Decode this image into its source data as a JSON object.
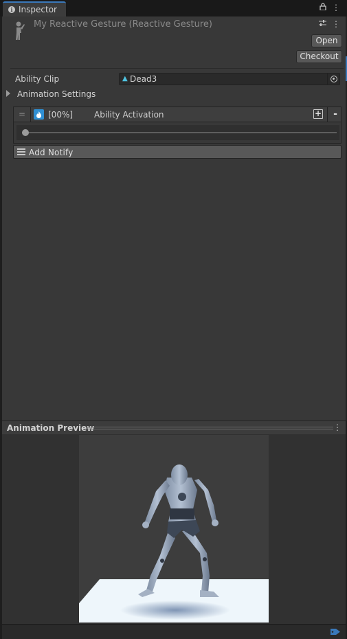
{
  "tab": {
    "label": "Inspector",
    "icon": "info-icon"
  },
  "header": {
    "title": "My Reactive Gesture (Reactive Gesture)",
    "open_label": "Open",
    "checkout_label": "Checkout"
  },
  "fields": {
    "ability_clip_label": "Ability Clip",
    "ability_clip_value": "Dead3",
    "animation_settings_label": "Animation Settings"
  },
  "activation": {
    "percent": "[00%]",
    "name": "Ability Activation",
    "slider_value": 0
  },
  "notify": {
    "label": "Add  Notify"
  },
  "preview": {
    "title": "Animation Preview"
  },
  "colors": {
    "accent": "#3a79bb",
    "activation_icon": "#2f8fd3",
    "clip_icon": "#4fc3e0"
  }
}
